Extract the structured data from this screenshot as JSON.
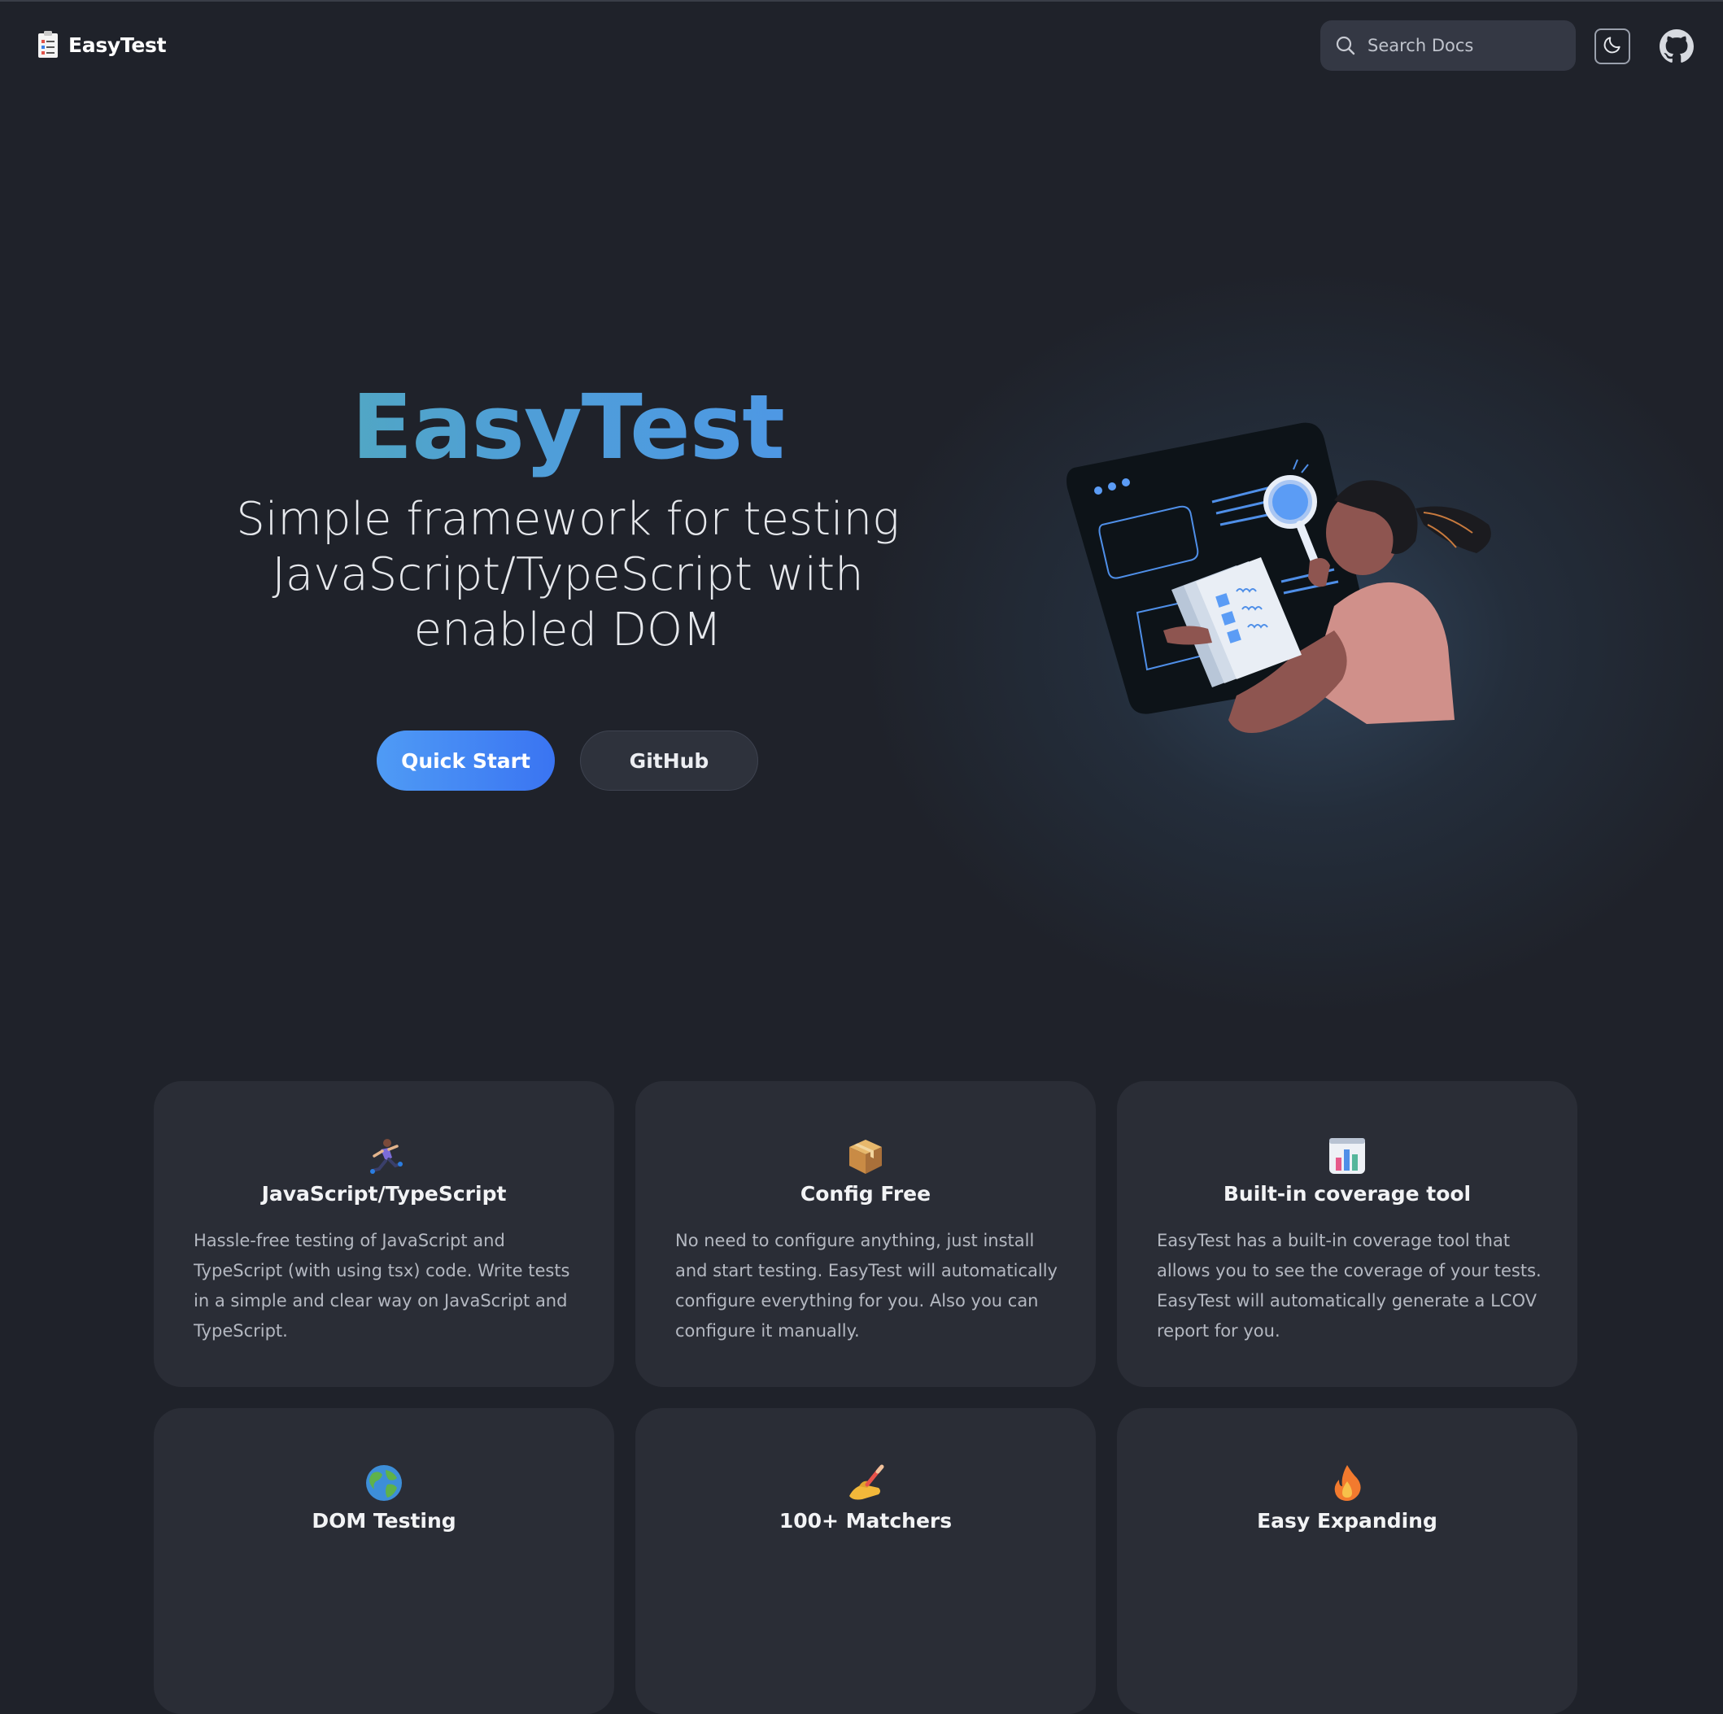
{
  "nav": {
    "brand": "EasyTest",
    "search_placeholder": "Search Docs",
    "theme_icon": "moon-icon",
    "github_icon": "github-icon"
  },
  "hero": {
    "title": "EasyTest",
    "subtitle": "Simple framework for testing JavaScript/TypeScript with enabled DOM",
    "primary_button": "Quick Start",
    "secondary_button": "GitHub"
  },
  "features": [
    {
      "icon": "runner-icon",
      "title": "JavaScript/TypeScript",
      "description": "Hassle-free testing of JavaScript and TypeScript (with using tsx) code. Write tests in a simple and clear way on JavaScript and TypeScript."
    },
    {
      "icon": "package-icon",
      "title": "Config Free",
      "description": "No need to configure anything, just install and start testing. EasyTest will automatically configure everything for you. Also you can configure it manually."
    },
    {
      "icon": "bar-chart-icon",
      "title": "Built-in coverage tool",
      "description": "EasyTest has a built-in coverage tool that allows you to see the coverage of your tests. EasyTest will automatically generate a LCOV report for you."
    },
    {
      "icon": "globe-icon",
      "title": "DOM Testing",
      "description": ""
    },
    {
      "icon": "writing-hand-icon",
      "title": "100+ Matchers",
      "description": ""
    },
    {
      "icon": "fire-icon",
      "title": "Easy Expanding",
      "description": ""
    }
  ],
  "colors": {
    "background": "#1f222a",
    "card": "#2a2d36",
    "accent": "#4d8ff5",
    "gradient_start": "#55b69b"
  }
}
